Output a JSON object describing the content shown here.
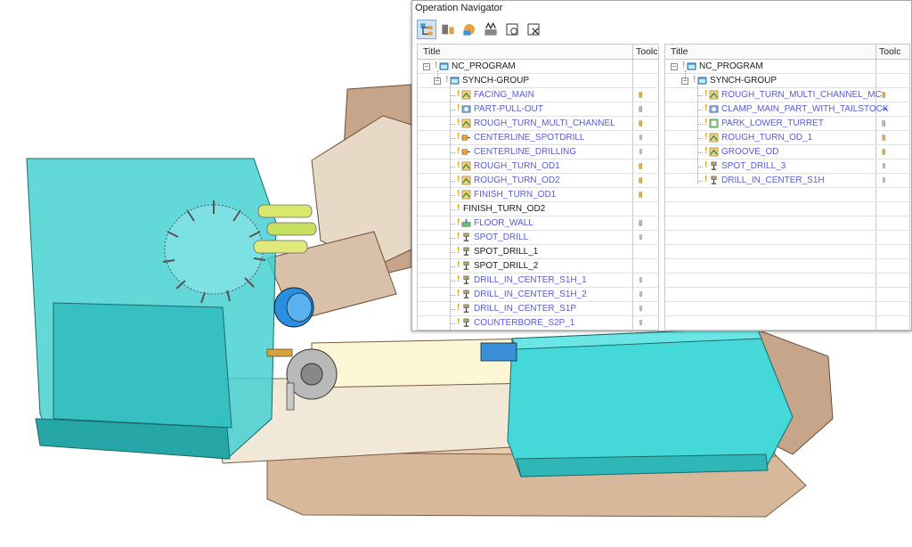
{
  "navigator": {
    "title": "Operation Navigator",
    "toolbar": [
      {
        "icon": "program-order-view-icon",
        "active": true
      },
      {
        "icon": "machine-tool-view-icon",
        "active": false
      },
      {
        "icon": "geometry-view-icon",
        "active": false
      },
      {
        "icon": "machining-method-view-icon",
        "active": false
      },
      {
        "icon": "new-operation-icon",
        "active": false
      },
      {
        "icon": "delete-operation-icon",
        "active": false
      }
    ],
    "left": {
      "columns": {
        "title": "Title",
        "tool": "Toolc"
      },
      "root": "NC_PROGRAM",
      "group": "SYNCH-GROUP",
      "operations": [
        {
          "name": "FACING_MAIN",
          "icon": "turning-op-icon",
          "tool": "turn-tool-icon",
          "style": "op"
        },
        {
          "name": "PART-PULL-OUT",
          "icon": "part-handling-op-icon",
          "tool": "generic-tool-icon",
          "style": "op"
        },
        {
          "name": "ROUGH_TURN_MULTI_CHANNEL",
          "icon": "turning-op-icon",
          "tool": "turn-tool-icon",
          "style": "op"
        },
        {
          "name": "CENTERLINE_SPOTDRILL",
          "icon": "centerline-op-icon",
          "tool": "drill-tool-icon",
          "style": "op"
        },
        {
          "name": "CENTERLINE_DRILLING",
          "icon": "centerline-op-icon",
          "tool": "drill-tool-icon",
          "style": "op"
        },
        {
          "name": "ROUGH_TURN_OD1",
          "icon": "turning-op-icon",
          "tool": "turn-tool-icon",
          "style": "op"
        },
        {
          "name": "ROUGH_TURN_OD2",
          "icon": "turning-op-icon",
          "tool": "turn-tool-icon",
          "style": "op"
        },
        {
          "name": "FINISH_TURN_OD1",
          "icon": "turning-op-icon",
          "tool": "turn-tool-icon",
          "style": "op"
        },
        {
          "name": "FINISH_TURN_OD2",
          "icon": "",
          "tool": "",
          "style": "plain"
        },
        {
          "name": "FLOOR_WALL",
          "icon": "mill-op-icon",
          "tool": "generic-tool-icon",
          "style": "op"
        },
        {
          "name": "SPOT_DRILL",
          "icon": "drill-op-icon",
          "tool": "drill-tool-icon",
          "style": "op"
        },
        {
          "name": "SPOT_DRILL_1",
          "icon": "drill-op-icon",
          "tool": "",
          "style": "plain"
        },
        {
          "name": "SPOT_DRILL_2",
          "icon": "drill-op-icon",
          "tool": "",
          "style": "plain"
        },
        {
          "name": "DRILL_IN_CENTER_S1H_1",
          "icon": "drill-op-icon",
          "tool": "drill-tool-icon",
          "style": "op"
        },
        {
          "name": "DRILL_IN_CENTER_S1H_2",
          "icon": "drill-op-icon",
          "tool": "drill-tool-icon",
          "style": "op"
        },
        {
          "name": "DRILL_IN_CENTER_S1P",
          "icon": "drill-op-icon",
          "tool": "drill-tool-icon",
          "style": "op"
        },
        {
          "name": "COUNTERBORE_S2P_1",
          "icon": "drill-op-icon",
          "tool": "drill-tool-icon",
          "style": "op"
        }
      ]
    },
    "right": {
      "columns": {
        "title": "Title",
        "tool": "Toolc"
      },
      "root": "NC_PROGRAM",
      "group": "SYNCH-GROUP",
      "operations": [
        {
          "name": "ROUGH_TURN_MULTI_CHANNEL_MC",
          "icon": "turning-op-icon",
          "tool": "turn-tool-icon",
          "style": "op"
        },
        {
          "name": "CLAMP_MAIN_PART_WITH_TAILSTOCK",
          "icon": "part-handling-op-icon",
          "tool": "tailstock-tool-icon",
          "style": "op"
        },
        {
          "name": "PARK_LOWER_TURRET",
          "icon": "park-op-icon",
          "tool": "generic-tool-icon",
          "style": "op"
        },
        {
          "name": "ROUGH_TURN_OD_1",
          "icon": "turning-op-icon",
          "tool": "turn-tool-icon",
          "style": "op"
        },
        {
          "name": "GROOVE_OD",
          "icon": "turning-op-icon",
          "tool": "turn-tool-icon",
          "style": "op"
        },
        {
          "name": "SPOT_DRILL_3",
          "icon": "drill-op-icon",
          "tool": "drill-tool-icon",
          "style": "op"
        },
        {
          "name": "DRILL_IN_CENTER_S1H",
          "icon": "drill-op-icon",
          "tool": "drill-tool-icon",
          "style": "op"
        }
      ]
    }
  },
  "colors": {
    "accent": "#5a5ad6",
    "warning": "#e8a000",
    "teal": "#3fd0d2",
    "machine_base": "#c9a98a"
  }
}
